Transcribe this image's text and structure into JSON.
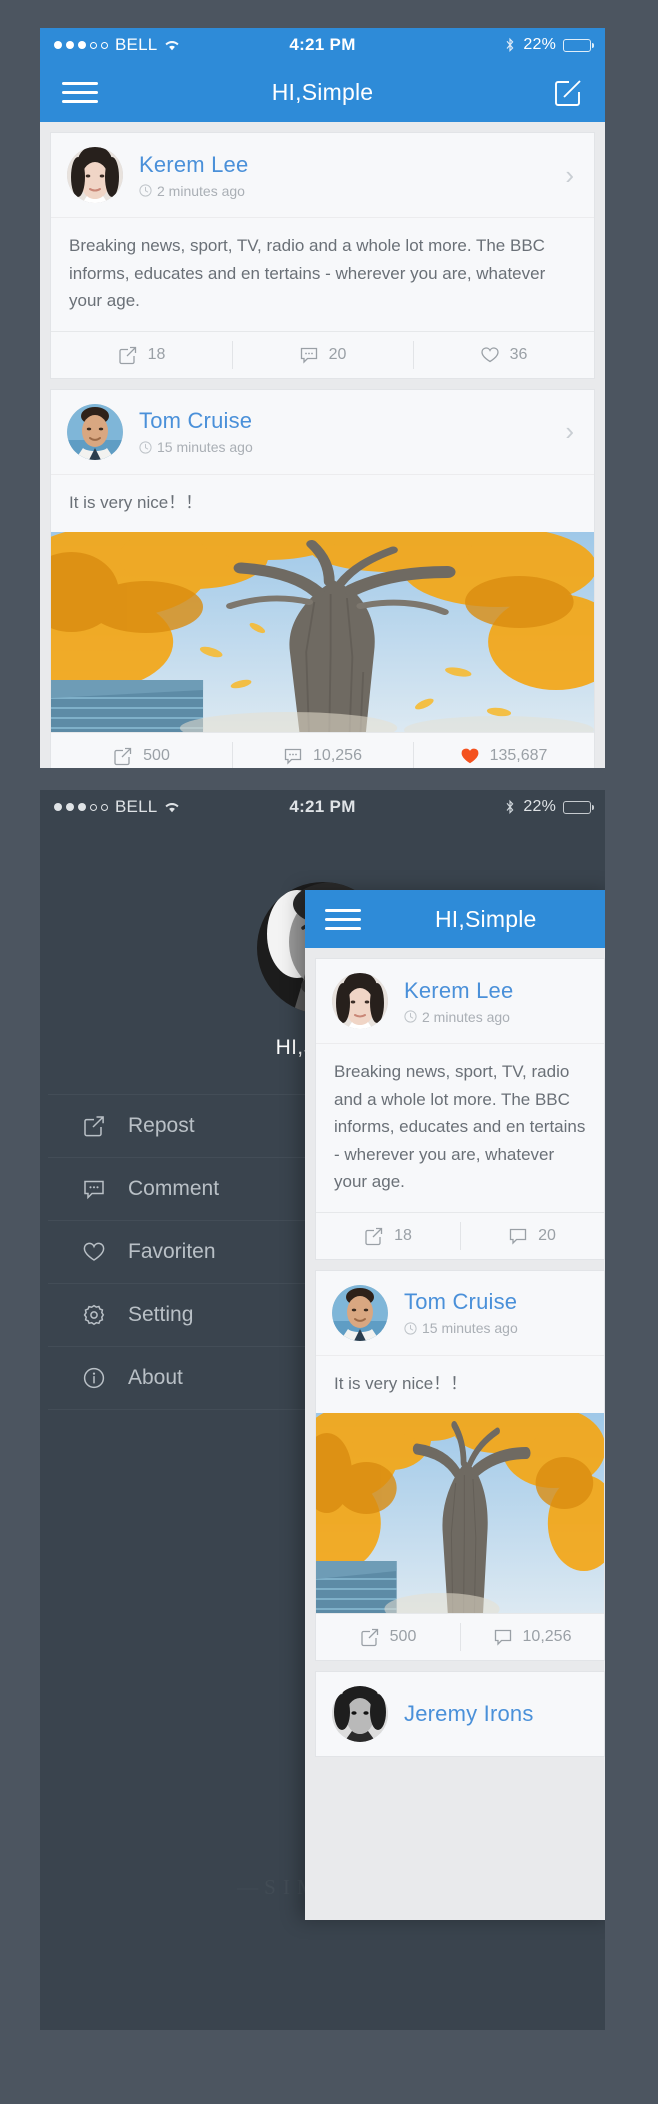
{
  "status_bar": {
    "signal_dots_filled": 3,
    "signal_dots_total": 5,
    "carrier": "BELL",
    "wifi_icon": "wifi-icon",
    "time": "4:21 PM",
    "bluetooth_icon": "bluetooth-icon",
    "battery_percent": "22%",
    "battery_level": 22
  },
  "nav": {
    "menu_icon": "hamburger-icon",
    "title": "HI,Simple",
    "compose_icon": "compose-icon"
  },
  "colors": {
    "brand_blue": "#2e8bd8",
    "link_blue": "#4a90d9",
    "liked_red": "#f4511e",
    "online_green": "#16b015",
    "drawer_bg": "#3a444e",
    "page_bg": "#4c5560"
  },
  "feed": {
    "posts": [
      {
        "author": "Kerem Lee",
        "time": "2 minutes ago",
        "clock_icon": "clock-icon",
        "chevron_icon": "chevron-right-icon",
        "body": "Breaking news, sport, TV, radio and a whole lot more. The BBC informs, educates and en tertains - wherever you are, whatever your age.",
        "has_photo": false,
        "actions": [
          {
            "icon": "repost-icon",
            "count": "18",
            "liked": false
          },
          {
            "icon": "comment-icon",
            "count": "20",
            "liked": false
          },
          {
            "icon": "heart-icon",
            "count": "36",
            "liked": false
          }
        ]
      },
      {
        "author": "Tom Cruise",
        "time": "15 minutes ago",
        "clock_icon": "clock-icon",
        "chevron_icon": "chevron-right-icon",
        "body": "It is very nice！！",
        "has_photo": true,
        "photo_alt": "autumn-tree-photo",
        "actions": [
          {
            "icon": "repost-icon",
            "count": "500",
            "liked": false
          },
          {
            "icon": "comment-icon",
            "count": "10,256",
            "liked": false
          },
          {
            "icon": "heart-icon",
            "count": "135,687",
            "liked": true
          }
        ]
      },
      {
        "author": "Jeremy Irons",
        "time": "",
        "clock_icon": "clock-icon",
        "chevron_icon": "chevron-right-icon",
        "body": "",
        "has_photo": false,
        "actions": []
      }
    ]
  },
  "drawer": {
    "avatar_alt": "user-profile-photo",
    "online_badge": "online-status-indicator",
    "profile_name": "HI,Simple",
    "menu": [
      {
        "icon": "repost-icon",
        "label": "Repost"
      },
      {
        "icon": "comment-icon",
        "label": "Comment"
      },
      {
        "icon": "heart-icon",
        "label": "Favoriten"
      },
      {
        "icon": "gear-icon",
        "label": "Setting"
      },
      {
        "icon": "info-icon",
        "label": "About"
      }
    ],
    "watermark": "SIMPLE"
  }
}
